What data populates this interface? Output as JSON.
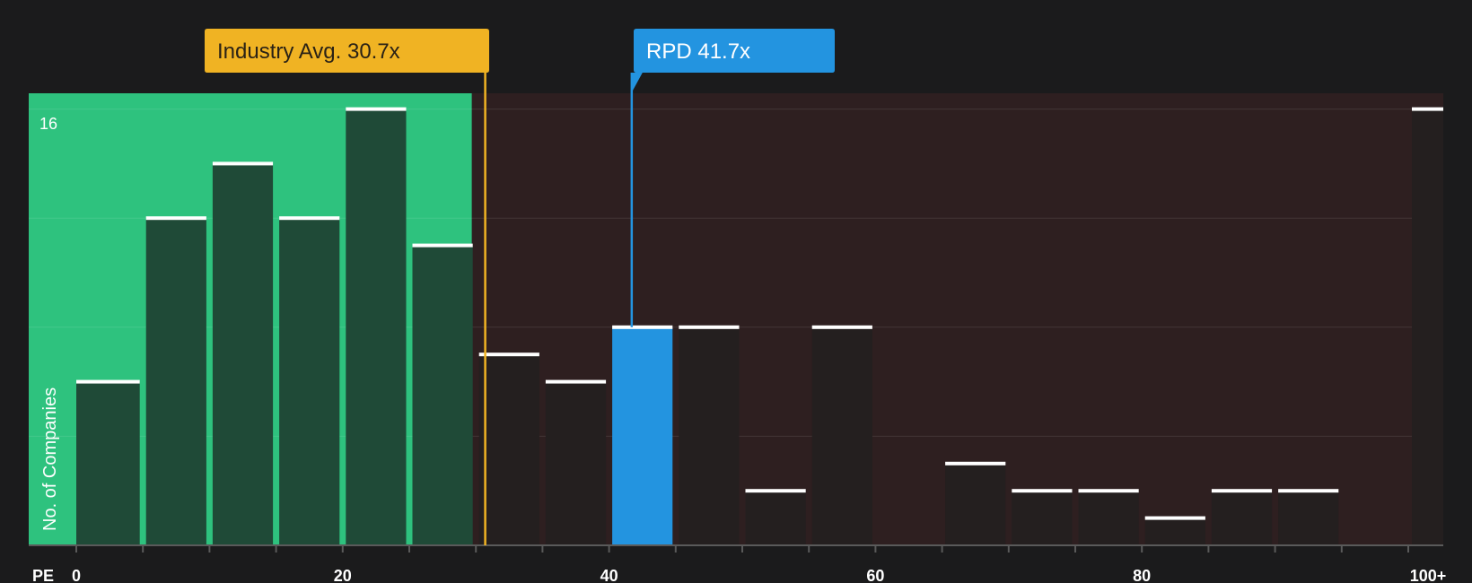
{
  "chart_data": {
    "type": "bar",
    "xlabel": "PE",
    "ylabel": "No. of Companies",
    "y_tick_label": "16",
    "ylim": [
      0,
      16
    ],
    "x_ticks": [
      {
        "value": 0,
        "label": "0"
      },
      {
        "value": 20,
        "label": "20"
      },
      {
        "value": 40,
        "label": "40"
      },
      {
        "value": 60,
        "label": "60"
      },
      {
        "value": 80,
        "label": "80"
      },
      {
        "value": 100,
        "label": "100+"
      }
    ],
    "bins": [
      {
        "start": 0,
        "end": 5,
        "count": 6
      },
      {
        "start": 5,
        "end": 10,
        "count": 12
      },
      {
        "start": 10,
        "end": 15,
        "count": 14
      },
      {
        "start": 15,
        "end": 20,
        "count": 12
      },
      {
        "start": 20,
        "end": 25,
        "count": 16
      },
      {
        "start": 25,
        "end": 30,
        "count": 11
      },
      {
        "start": 30,
        "end": 35,
        "count": 7
      },
      {
        "start": 35,
        "end": 40,
        "count": 6
      },
      {
        "start": 40,
        "end": 45,
        "count": 8
      },
      {
        "start": 45,
        "end": 50,
        "count": 8
      },
      {
        "start": 50,
        "end": 55,
        "count": 2
      },
      {
        "start": 55,
        "end": 60,
        "count": 8
      },
      {
        "start": 60,
        "end": 65,
        "count": 0
      },
      {
        "start": 65,
        "end": 70,
        "count": 3
      },
      {
        "start": 70,
        "end": 75,
        "count": 2
      },
      {
        "start": 75,
        "end": 80,
        "count": 2
      },
      {
        "start": 80,
        "end": 85,
        "count": 1
      },
      {
        "start": 85,
        "end": 90,
        "count": 2
      },
      {
        "start": 90,
        "end": 95,
        "count": 2
      },
      {
        "start": 95,
        "end": 100,
        "count": 0
      },
      {
        "start": 100,
        "end": 105,
        "count": 16
      }
    ],
    "highlight_bin_start": 40,
    "fair_range_max": 29.7,
    "industry_avg": {
      "value": 30.7,
      "label": "Industry Avg. 30.7x"
    },
    "company": {
      "value": 41.7,
      "label": "RPD 41.7x"
    },
    "colors": {
      "background": "#1b1b1c",
      "fair_zone": "#2ec27e",
      "high_zone": "#2e1f20",
      "bar_in_fair": "#1f4a37",
      "bar_default": "#241f1f",
      "bar_highlight": "#2394e0",
      "bar_cap": "#ffffff",
      "industry": "#f0b323",
      "company": "#2394e0",
      "axis_text": "#ffffff"
    }
  }
}
